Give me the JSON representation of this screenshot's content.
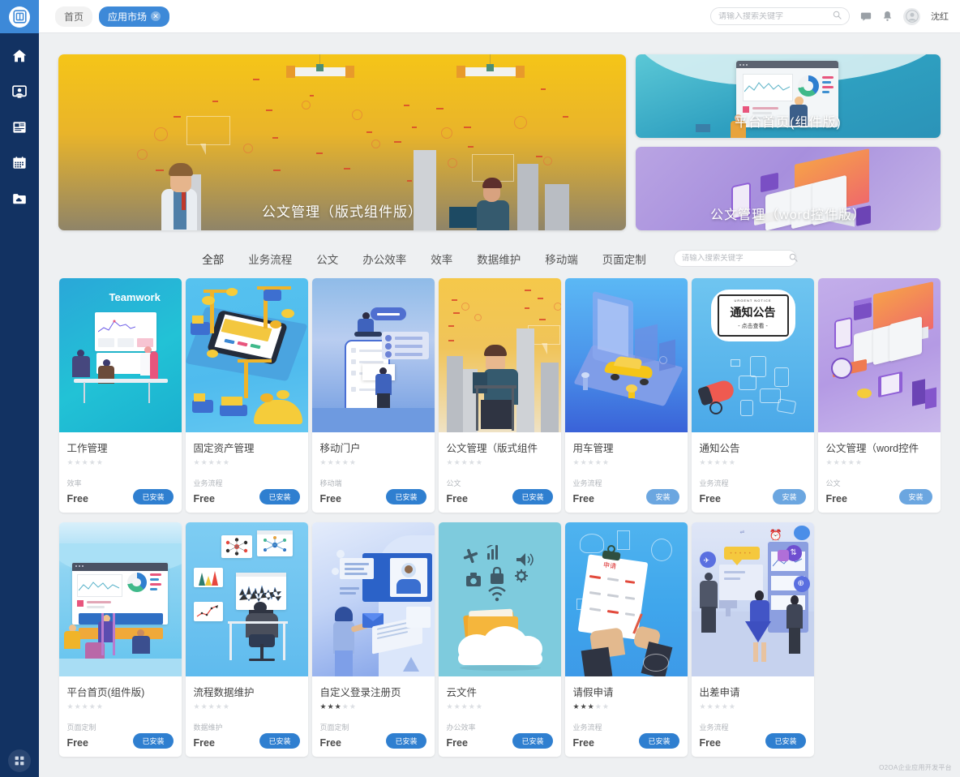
{
  "rail": {
    "logo_icon": "o2oa-logo-icon",
    "items": [
      {
        "name": "home",
        "icon": "home-icon"
      },
      {
        "name": "portrait",
        "icon": "user-screen-icon"
      },
      {
        "name": "news",
        "icon": "newspaper-icon"
      },
      {
        "name": "calendar",
        "icon": "calendar-icon"
      },
      {
        "name": "files",
        "icon": "cloud-folder-icon"
      }
    ],
    "bottom_icon": "apps-grid-icon"
  },
  "header": {
    "breadcrumbs": [
      {
        "label": "首页",
        "active": false
      },
      {
        "label": "应用市场",
        "active": true,
        "closable": true
      }
    ],
    "close_glyph": "✕",
    "search": {
      "placeholder": "请输入搜索关键字",
      "value": "",
      "icon": "search-icon"
    },
    "icons": [
      {
        "name": "message-icon"
      },
      {
        "name": "notification-bell-icon"
      }
    ],
    "user": {
      "name": "沈红",
      "avatar_icon": "avatar-icon"
    }
  },
  "banners": {
    "main": {
      "caption": "公文管理（版式组件版）",
      "theme": "#e9b42a"
    },
    "side": [
      {
        "caption": "平台首页(组件版)",
        "theme": "#2e9fc0"
      },
      {
        "caption": "公文管理（word控件版）",
        "theme": "#a78fdd"
      }
    ]
  },
  "filters": {
    "items": [
      "全部",
      "业务流程",
      "公文",
      "办公效率",
      "效率",
      "数据维护",
      "移动端",
      "页面定制"
    ],
    "active_index": 0,
    "search": {
      "placeholder": "请输入搜索关键字",
      "value": "",
      "icon": "search-icon"
    }
  },
  "cards": [
    {
      "title": "工作管理",
      "stars": 0,
      "category": "效率",
      "price": "Free",
      "button": "已安装",
      "installed": true,
      "thumb": "teamwork",
      "thumb_label": "Teamwork"
    },
    {
      "title": "固定资产管理",
      "stars": 0,
      "category": "业务流程",
      "price": "Free",
      "button": "已安装",
      "installed": true,
      "thumb": "assets"
    },
    {
      "title": "移动门户",
      "stars": 0,
      "category": "移动端",
      "price": "Free",
      "button": "已安装",
      "installed": true,
      "thumb": "mobile"
    },
    {
      "title": "公文管理（版式组件",
      "stars": 0,
      "category": "公文",
      "price": "Free",
      "button": "已安装",
      "installed": true,
      "thumb": "doc-yellow"
    },
    {
      "title": "用车管理",
      "stars": 0,
      "category": "业务流程",
      "price": "Free",
      "button": "安装",
      "installed": false,
      "thumb": "car"
    },
    {
      "title": "通知公告",
      "stars": 0,
      "category": "业务流程",
      "price": "Free",
      "button": "安装",
      "installed": false,
      "thumb": "notice"
    },
    {
      "title": "公文管理（word控件",
      "stars": 0,
      "category": "公文",
      "price": "Free",
      "button": "安装",
      "installed": false,
      "thumb": "doc-purple"
    },
    {
      "title": "平台首页(组件版)",
      "stars": 0,
      "category": "页面定制",
      "price": "Free",
      "button": "已安装",
      "installed": true,
      "thumb": "platform"
    },
    {
      "title": "流程数据维护",
      "stars": 0,
      "category": "数据维护",
      "price": "Free",
      "button": "已安装",
      "installed": true,
      "thumb": "dataops"
    },
    {
      "title": "自定义登录注册页",
      "stars": 3,
      "category": "页面定制",
      "price": "Free",
      "button": "已安装",
      "installed": true,
      "thumb": "login"
    },
    {
      "title": "云文件",
      "stars": 0,
      "category": "办公效率",
      "price": "Free",
      "button": "已安装",
      "installed": true,
      "thumb": "cloud"
    },
    {
      "title": "请假申请",
      "stars": 3,
      "category": "业务流程",
      "price": "Free",
      "button": "已安装",
      "installed": true,
      "thumb": "leave"
    },
    {
      "title": "出差申请",
      "stars": 0,
      "category": "业务流程",
      "price": "Free",
      "button": "已安装",
      "installed": true,
      "thumb": "travel"
    }
  ],
  "footer": {
    "note": "O2OA企业应用开发平台"
  },
  "colors": {
    "rail_bg": "#123262",
    "rail_logo_bg": "#3d89d8",
    "accent": "#2f7fd0",
    "accent_light": "#6ba6e0",
    "page_bg": "#eef0f2"
  }
}
